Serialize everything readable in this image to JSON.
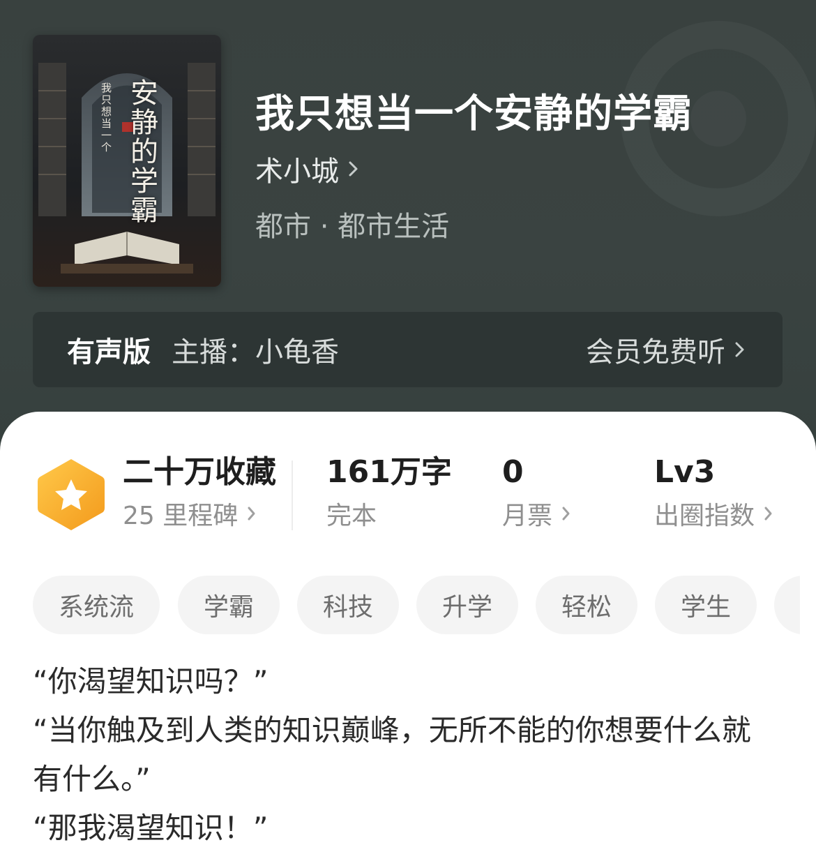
{
  "book": {
    "title": "我只想当一个安静的学霸",
    "author": "术小城",
    "genre": "都市 · 都市生活",
    "cover_title": "安静的学霸",
    "cover_subtitle": "我只想当一个"
  },
  "audio": {
    "label": "有声版",
    "narrator": "主播：小龟香",
    "vip_label": "会员免费听"
  },
  "stats": {
    "collections": "二十万收藏",
    "milestones": "25 里程碑",
    "word_count": "161万字",
    "status": "完本",
    "monthly_tickets": "0",
    "monthly_tickets_label": "月票",
    "level": "Lv3",
    "level_label": "出圈指数"
  },
  "tags": [
    "系统流",
    "学霸",
    "科技",
    "升学",
    "轻松",
    "学生"
  ],
  "description": [
    "“你渴望知识吗？”",
    "“当你触及到人类的知识巅峰，无所不能的你想要什么就有什么。”",
    "“那我渴望知识！”"
  ],
  "colors": {
    "header_bg": "#39413f",
    "badge_orange": "#f5b02e",
    "tag_bg": "#f4f4f4"
  }
}
